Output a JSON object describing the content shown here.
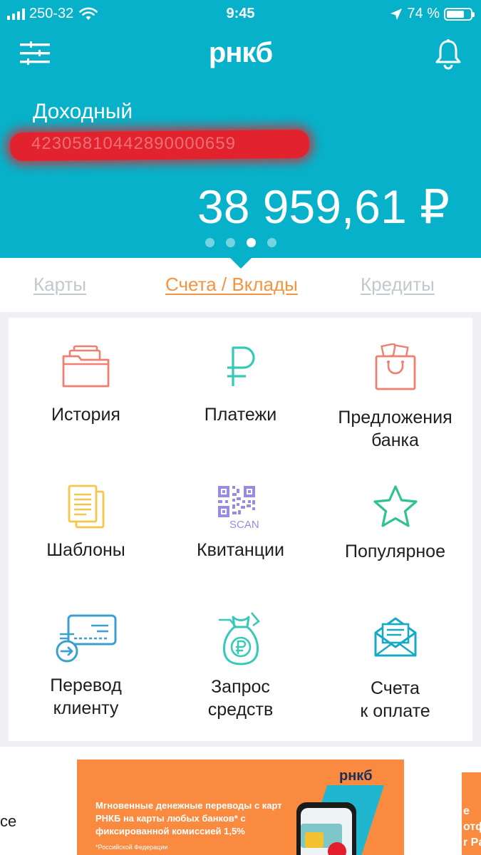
{
  "status": {
    "carrier": "250-32",
    "time": "9:45",
    "battery": "74 %",
    "battery_level": 0.74
  },
  "header": {
    "logo": "рнкб",
    "account_name": "Доходный",
    "account_number": "42305810442890000659",
    "balance": "38 959,61 ₽",
    "page_count": 4,
    "active_page": 3
  },
  "tabs": {
    "cards": "Карты",
    "accounts": "Счета / Вклады",
    "credits": "Кредиты"
  },
  "grid": [
    {
      "label": "История",
      "icon": "folder-icon"
    },
    {
      "label": "Платежи",
      "icon": "ruble-icon"
    },
    {
      "label": "Предложения\nбанка",
      "icon": "gift-bag-icon"
    },
    {
      "label": "Шаблоны",
      "icon": "documents-icon"
    },
    {
      "label": "Квитанции",
      "icon": "qr-scan-icon",
      "icon_text": "SCAN"
    },
    {
      "label": "Популярное",
      "icon": "star-icon"
    },
    {
      "label": "Перевод\nклиенту",
      "icon": "card-transfer-icon"
    },
    {
      "label": "Запрос\nсредств",
      "icon": "money-bag-icon"
    },
    {
      "label": "Счета\nк оплате",
      "icon": "envelope-invoice-icon"
    }
  ],
  "banners": {
    "prev_fragment": "сe",
    "main": {
      "logo": "рнкб",
      "text": "Мгновенные денежные переводы с карт РНКБ на карты любых банков* с фиксированной комиссией 1,5%",
      "note": "*Российской Федерации"
    },
    "next_fragment": "е\nотф\nr Pa"
  },
  "colors": {
    "header_bg": "#06b1c9",
    "accent_orange": "#f4943f",
    "icon_coral": "#f07f72",
    "icon_teal": "#35c9b7",
    "icon_yellow": "#f5c64a",
    "icon_purple": "#9b8be0",
    "icon_green": "#2ec48a",
    "icon_blue": "#3b9fd0",
    "banner_orange": "#f98a3f"
  }
}
